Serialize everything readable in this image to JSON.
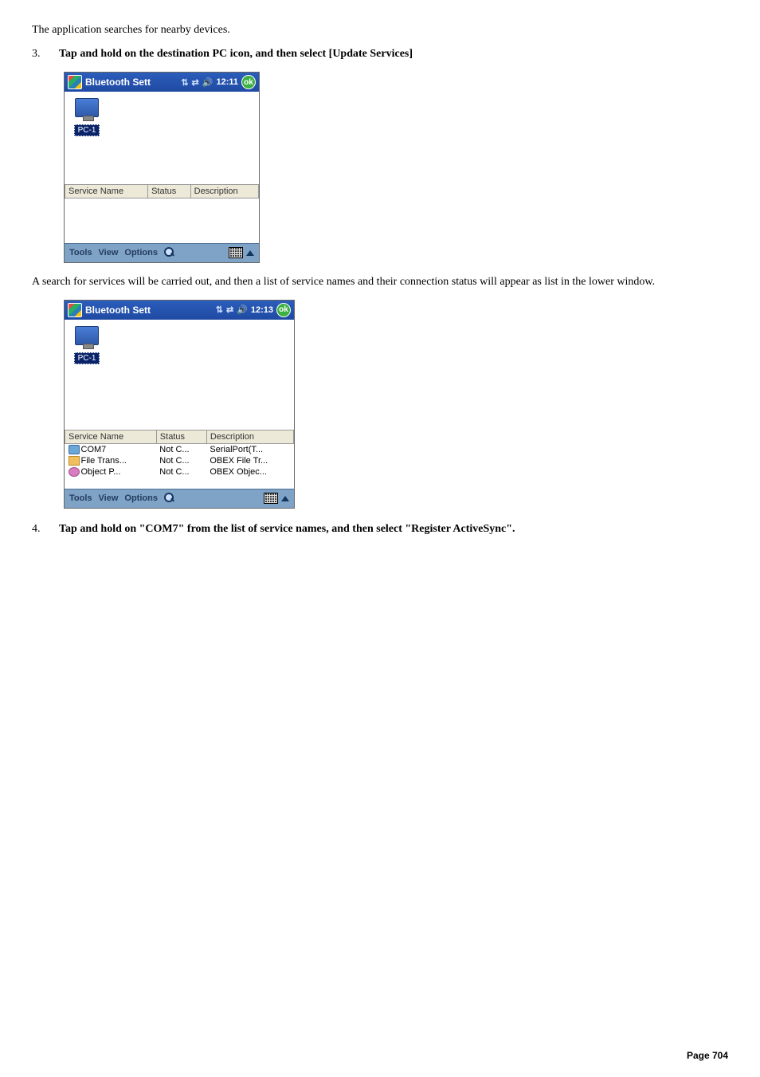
{
  "intro_text": "The application searches for nearby devices.",
  "step3": {
    "num": "3.",
    "text": "Tap and hold on the destination PC icon, and then select [Update Services]"
  },
  "win1": {
    "title": "Bluetooth Sett",
    "clock": "12:11",
    "ok": "ok",
    "pc_label": "PC-1",
    "cols": {
      "name": "Service Name",
      "status": "Status",
      "desc": "Description"
    },
    "menu": {
      "tools": "Tools",
      "view": "View",
      "options": "Options"
    }
  },
  "mid_text": "A search for services will be carried out, and then a list of service names and their connection status will appear as list in the lower window.",
  "win2": {
    "title": "Bluetooth Sett",
    "clock": "12:13",
    "ok": "ok",
    "pc_label": "PC-1",
    "cols": {
      "name": "Service Name",
      "status": "Status",
      "desc": "Description"
    },
    "rows": [
      {
        "name": "COM7",
        "status": "Not C...",
        "desc": "SerialPort(T..."
      },
      {
        "name": "File Trans...",
        "status": "Not C...",
        "desc": "OBEX File Tr..."
      },
      {
        "name": "Object P...",
        "status": "Not C...",
        "desc": "OBEX Objec..."
      }
    ],
    "menu": {
      "tools": "Tools",
      "view": "View",
      "options": "Options"
    }
  },
  "step4": {
    "num": "4.",
    "text": "Tap and hold on \"COM7\" from the list of service names, and then select \"Register ActiveSync\"."
  },
  "footer": {
    "label": "Page",
    "num": "704"
  }
}
